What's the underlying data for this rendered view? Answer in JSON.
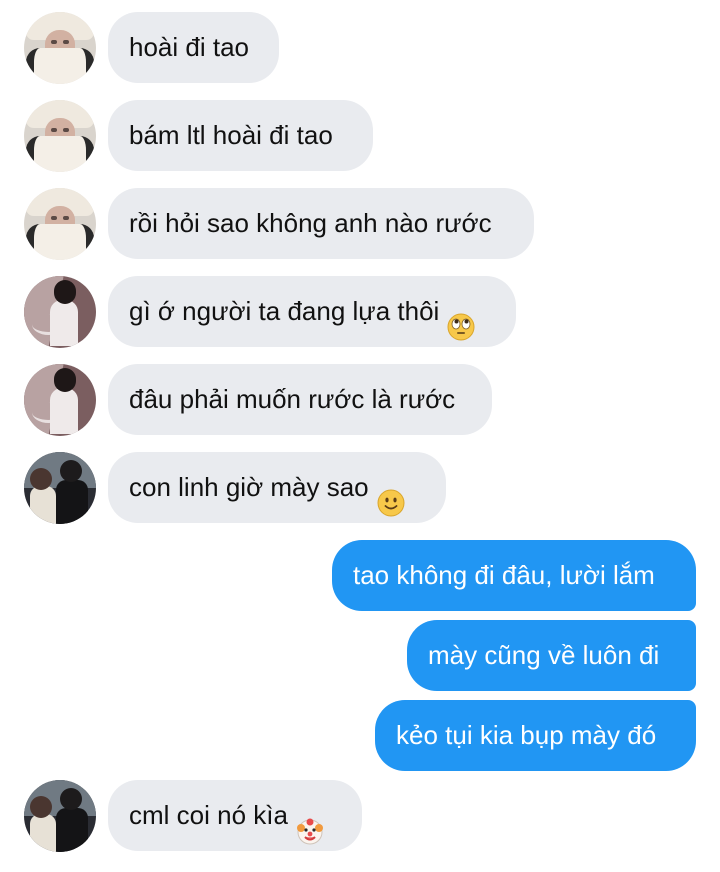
{
  "messages": [
    {
      "side": "in",
      "avatar": "avatar-hooded-girl",
      "text": "hoài đi tao",
      "emoji": null
    },
    {
      "side": "in",
      "avatar": "avatar-hooded-girl",
      "text": "bám ltl hoài đi tao",
      "emoji": null
    },
    {
      "side": "in",
      "avatar": "avatar-hooded-girl",
      "text": "rồi hỏi sao không anh nào rước",
      "emoji": null
    },
    {
      "side": "in",
      "avatar": "avatar-girl-mirror",
      "text": "gì ớ người ta đang lựa thôi",
      "emoji": "eye-roll-emoji"
    },
    {
      "side": "in",
      "avatar": "avatar-girl-mirror",
      "text": "đâu phải muốn rước là rước",
      "emoji": null
    },
    {
      "side": "in",
      "avatar": "avatar-couple",
      "text": "con linh giờ mày sao",
      "emoji": "smile-emoji"
    },
    {
      "side": "out",
      "avatar": null,
      "text": "tao không đi đâu, lười lắm",
      "emoji": null
    },
    {
      "side": "out",
      "avatar": null,
      "text": "mày cũng về luôn đi",
      "emoji": null
    },
    {
      "side": "out",
      "avatar": null,
      "text": "kẻo tụi kia bụp mày đó",
      "emoji": null
    },
    {
      "side": "in",
      "avatar": "avatar-couple",
      "text": "cml coi nó kìa",
      "emoji": "clown-emoji"
    }
  ],
  "colors": {
    "incoming_bubble": "#e9ebef",
    "outgoing_bubble": "#2196f3",
    "incoming_text": "#111111",
    "outgoing_text": "#ffffff"
  }
}
